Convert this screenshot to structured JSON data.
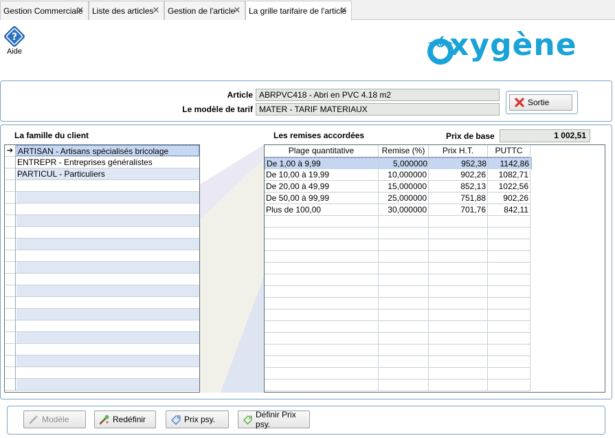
{
  "tabs": [
    {
      "label": "Gestion Commerciale",
      "active": false
    },
    {
      "label": "Liste des articles",
      "active": false
    },
    {
      "label": "Gestion de l'article",
      "active": false
    },
    {
      "label": "La grille tarifaire de l'article",
      "active": true
    }
  ],
  "toolbar": {
    "help_label": "Aide"
  },
  "logo": {
    "text": "xygène",
    "color": "#1aa3d8"
  },
  "form": {
    "article_label": "Article",
    "article_value": "ABRPVC418 - Abri en PVC 4.18 m2",
    "modele_label": "Le modèle de tarif",
    "modele_value": "MATER - TARIF MATERIAUX",
    "sortie_label": "Sortie"
  },
  "famille": {
    "title": "La famille du client",
    "items": [
      "ARTISAN - Artisans spécialisés bricolage",
      "ENTREPR - Entreprises généralistes",
      "PARTICUL - Particuliers"
    ],
    "selected_index": 0
  },
  "remises": {
    "title": "Les remises accordées",
    "prix_base_label": "Prix de base",
    "prix_base_value": "1 002,51",
    "columns": [
      "Plage quantitative",
      "Remise (%)",
      "Prix H.T.",
      "PUTTC"
    ],
    "rows": [
      [
        "De 1,00 à 9,99",
        "5,000000",
        "952,38",
        "1142,86"
      ],
      [
        "De 10,00 à 19,99",
        "10,000000",
        "902,26",
        "1082,71"
      ],
      [
        "De 20,00 à 49,99",
        "15,000000",
        "852,13",
        "1022,56"
      ],
      [
        "De 50,00 à 99,99",
        "25,000000",
        "751,88",
        "902,26"
      ],
      [
        "Plus de 100,00",
        "30,000000",
        "701,76",
        "842,11"
      ]
    ],
    "selected_index": 0
  },
  "actions": {
    "modele": "Modèle",
    "redefinir": "Redéfinir",
    "prix_psy": "Prix psy.",
    "definir_prix_psy": "Définir Prix psy."
  },
  "colors": {
    "accent": "#1aa3d8",
    "frame": "#7aa6c9",
    "row_alt": "#dfe7f5",
    "row_sel": "#c4d6f0"
  }
}
